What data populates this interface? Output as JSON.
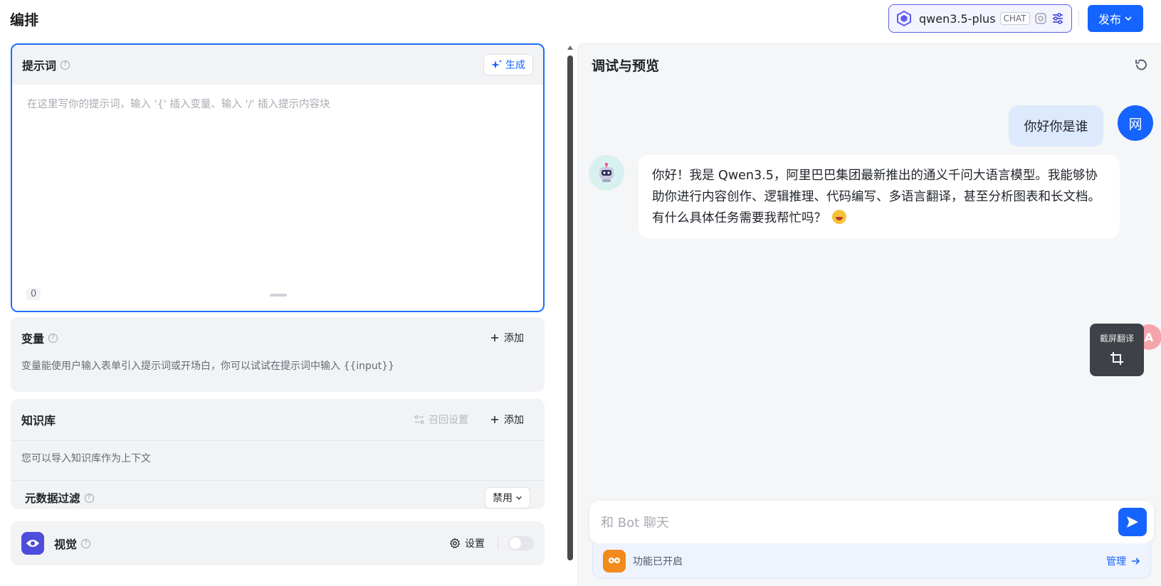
{
  "header": {
    "title": "编排",
    "model": {
      "name": "qwen3.5-plus",
      "tag": "CHAT"
    },
    "publish_label": "发布"
  },
  "prompt": {
    "title": "提示词",
    "generate_label": "生成",
    "placeholder": "在这里写你的提示词，输入 '{' 插入变量、输入 '/' 插入提示内容块",
    "char_count": "0"
  },
  "variables": {
    "title": "变量",
    "add_label": "添加",
    "description": "变量能使用户输入表单引入提示词或开场白，你可以试试在提示词中输入 {{input}}"
  },
  "knowledge": {
    "title": "知识库",
    "recall_label": "召回设置",
    "add_label": "添加",
    "description": "您可以导入知识库作为上下文",
    "metadata_filter_label": "元数据过滤",
    "metadata_filter_value": "禁用"
  },
  "vision": {
    "title": "视觉",
    "settings_label": "设置",
    "enabled": false
  },
  "preview": {
    "title": "调试与预览",
    "user_message": "你好你是谁",
    "user_avatar_text": "网",
    "bot_message": "你好！我是 Qwen3.5，阿里巴巴集团最新推出的通义千问大语言模型。我能够协助你进行内容创作、逻辑推理、代码编写、多语言翻译，甚至分析图表和长文档。有什么具体任务需要我帮忙吗？",
    "input_placeholder": "和 Bot 聊天",
    "features_status": "功能已开启",
    "manage_label": "管理"
  },
  "float_widget": {
    "label": "截屏翻译",
    "badge": "A"
  },
  "colors": {
    "accent": "#1664ff",
    "vision_icon": "#4d4ddb",
    "features_icon": "#f28b1c",
    "user_bubble": "#dde9fd"
  }
}
